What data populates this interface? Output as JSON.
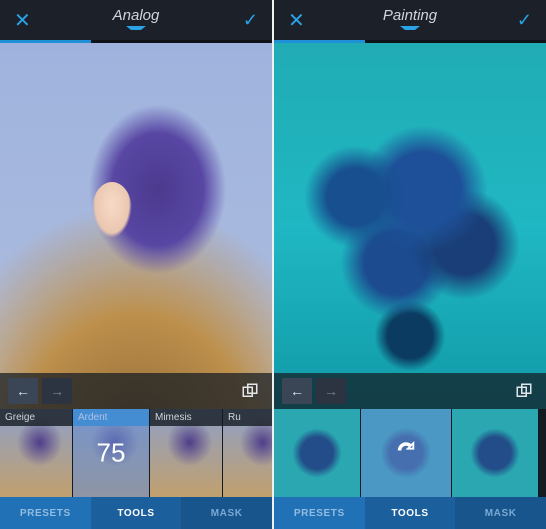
{
  "accent_color": "#2aa2e6",
  "left": {
    "title": "Analog",
    "close": "✕",
    "confirm": "✓",
    "progress_segments": 3,
    "progress_active": 1,
    "undo": "←",
    "redo": "→",
    "presets": [
      {
        "label": "Greige"
      },
      {
        "label": "Ardent",
        "selected": true,
        "value": 75
      },
      {
        "label": "Mimesis"
      },
      {
        "label": "Ru"
      }
    ],
    "tabs": [
      {
        "label": "PRESETS"
      },
      {
        "label": "TOOLS",
        "active": true
      },
      {
        "label": "MASK"
      }
    ]
  },
  "right": {
    "title": "Painting",
    "close": "✕",
    "confirm": "✓",
    "progress_segments": 3,
    "progress_active": 1,
    "undo": "←",
    "redo": "→",
    "presets": [
      {
        "paint": true
      },
      {
        "paint": true,
        "selected": true
      },
      {
        "paint": true
      }
    ],
    "tabs": [
      {
        "label": "PRESETS"
      },
      {
        "label": "TOOLS",
        "active": true
      },
      {
        "label": "MASK"
      }
    ]
  }
}
